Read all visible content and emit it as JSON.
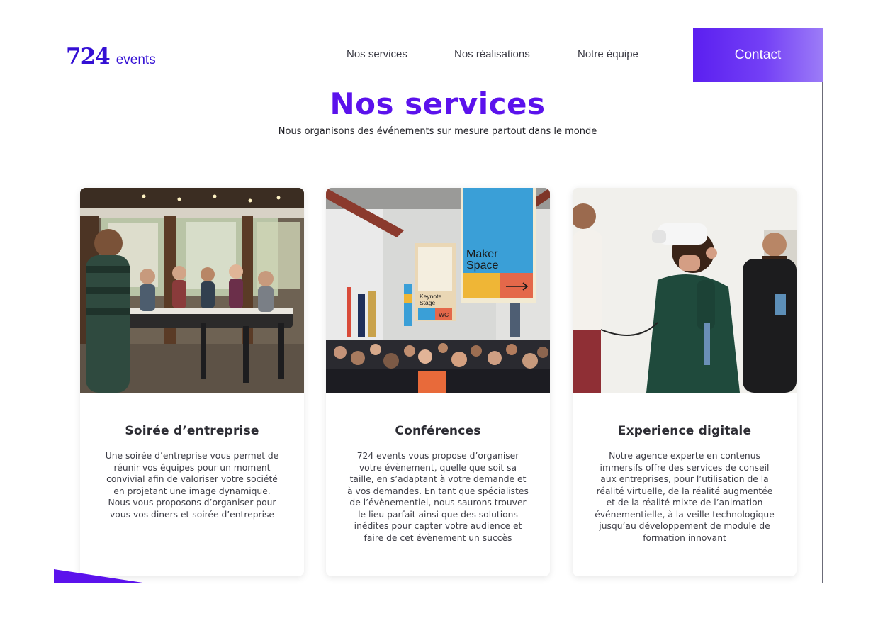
{
  "header": {
    "logo_number": "724",
    "logo_word": "events",
    "nav": [
      {
        "label": "Nos services"
      },
      {
        "label": "Nos réalisations"
      },
      {
        "label": "Notre équipe"
      }
    ],
    "contact_label": "Contact"
  },
  "section": {
    "title": "Nos services",
    "subtitle": "Nous organisons des événements sur mesure partout dans le monde"
  },
  "cards": [
    {
      "title": "Soirée d’entreprise",
      "description": "Une soirée d’entreprise vous permet de réunir vos équipes pour un moment convivial afin de valoriser votre société en projetant une image dynamique. Nous vous proposons d’organiser pour vous vos diners et soirée d’entreprise"
    },
    {
      "title": "Conférences",
      "description": "724 events vous propose d’organiser votre évènement, quelle que soit sa taille, en s’adaptant à votre demande et à vos demandes. En tant que spécialistes de l’évènementiel, nous saurons trouver le lieu parfait ainsi que des solutions inédites pour capter votre audience et faire de cet évènement un succès",
      "image_text": {
        "sign_main": "Maker Space",
        "sign_small": "Keynote Stage",
        "sign_wc": "WC"
      }
    },
    {
      "title": "Experience digitale",
      "description": "Notre agence experte en contenus immersifs offre des services de conseil aux entreprises, pour l’utilisation de la réalité virtuelle, de la réalité augmentée et de la réalité mixte de l’animation événementielle, à la veille technologique jusqu’au développement de module de formation innovant"
    }
  ],
  "colors": {
    "brand": "#5b12ec",
    "logo": "#3410d4",
    "contact_gradient_start": "#5b1ff0",
    "contact_gradient_end": "#9c7cf7"
  }
}
